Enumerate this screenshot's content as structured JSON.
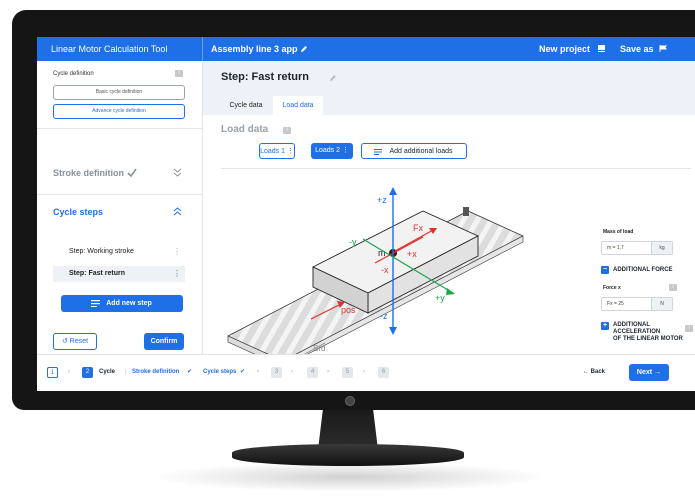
{
  "header": {
    "app_title": "Linear Motor Calculation Tool",
    "project_name": "Assembly line 3 app",
    "new_project": "New project",
    "save_as": "Save as"
  },
  "sidebar": {
    "cycle_definition_label": "Cycle definition",
    "basic_btn": "Basic cycle definition",
    "advanced_btn": "Advance cycle definition",
    "stroke_definition": "Stroke definition",
    "cycle_steps_title": "Cycle steps",
    "steps": [
      {
        "label": "Step: Working stroke"
      },
      {
        "label": "Step: Fast return"
      }
    ],
    "add_step": "Add new step",
    "reset": "Reset",
    "confirm": "Confirm"
  },
  "main": {
    "step_title": "Step: Fast return",
    "tabs": [
      "Cycle data",
      "Load data"
    ],
    "section_title": "Load data",
    "loads": [
      "Loads 1",
      "Loads 2"
    ],
    "add_loads": "Add additional loads"
  },
  "diagram": {
    "labels": {
      "pz": "+z",
      "nz": "-z",
      "px": "+x",
      "nx": "-x",
      "py": "+y",
      "ny": "-y",
      "m": "m",
      "fx": "Fx",
      "pos": "pos",
      "s": "Srd"
    },
    "colors": {
      "z_axis": "#1f6fe6",
      "x_axis": "#e03030",
      "y_axis": "#1aa84a"
    }
  },
  "form": {
    "mass_label": "Mass of load",
    "mass_value": "m = 1,7",
    "mass_unit": "kg",
    "additional_force": "ADDITIONAL FORCE",
    "force_label": "Force x",
    "force_value": "Fx = 25",
    "force_unit": "N",
    "additional_accel_line1": "ADDITIONAL ACCELERATION",
    "additional_accel_line2": "OF THE LINEAR MOTOR"
  },
  "footer": {
    "step1": "1",
    "step2": "2",
    "cycle": "Cycle",
    "stroke_definition": "Stroke definition",
    "cycle_steps": "Cycle steps",
    "step3": "3",
    "step4": "4",
    "step5": "5",
    "step6": "6",
    "back": "Back",
    "next": "Next"
  }
}
